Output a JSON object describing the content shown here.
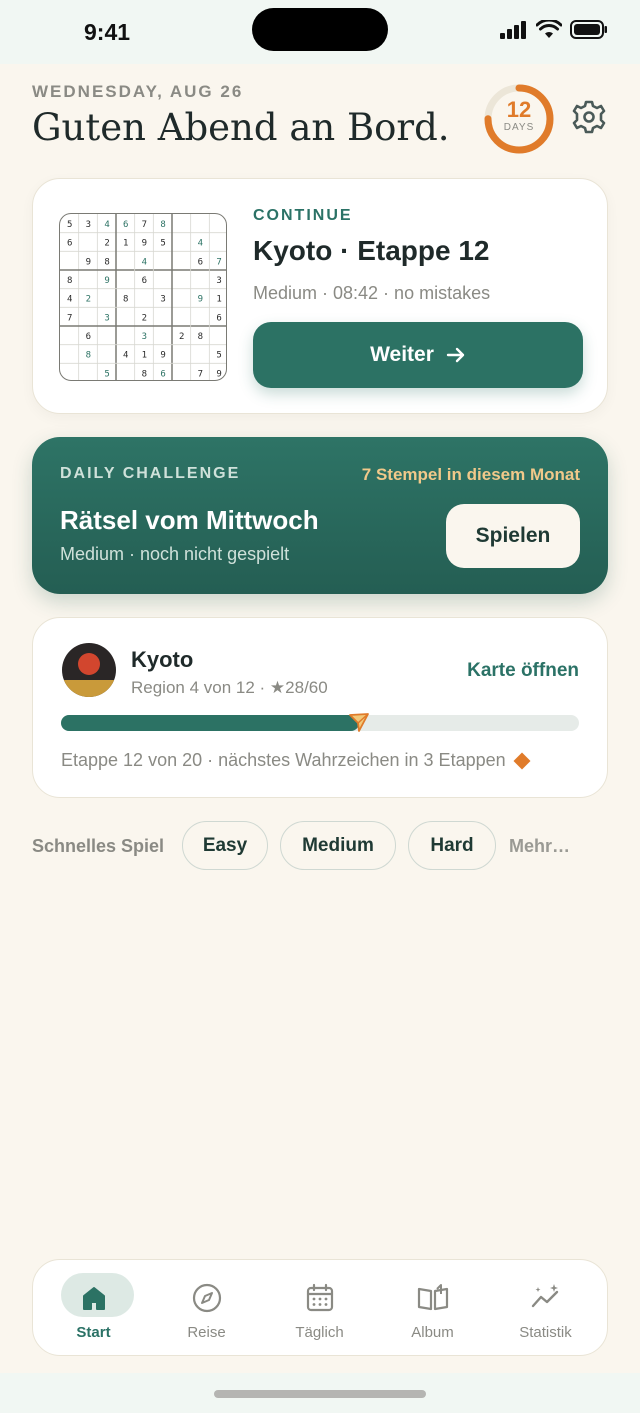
{
  "status_bar": {
    "time": "9:41"
  },
  "header": {
    "date": "WEDNESDAY, AUG 26",
    "greeting": "Guten Abend an Bord.",
    "streak": {
      "count": "12",
      "unit": "DAYS",
      "progress": 0.75
    },
    "settings_icon": "gear-icon"
  },
  "continue_card": {
    "label": "CONTINUE",
    "title": "Kyoto · Etappe 12",
    "subtitle": "Medium · 08:42 · no mistakes",
    "button_label": "Weiter",
    "button_icon": "arrow-right-icon",
    "mini_grid": [
      [
        "5",
        "3",
        "4",
        "6",
        "7",
        "8",
        "",
        "",
        ""
      ],
      [
        "6",
        "",
        "2",
        "1",
        "9",
        "5",
        "",
        "4",
        ""
      ],
      [
        "",
        "9",
        "8",
        "",
        "4",
        "",
        "",
        "6",
        "7"
      ],
      [
        "8",
        "",
        "9",
        "",
        "6",
        "",
        "",
        "",
        "3"
      ],
      [
        "4",
        "2",
        "",
        "8",
        "",
        "3",
        "",
        "9",
        "1"
      ],
      [
        "7",
        "",
        "3",
        "",
        "2",
        "",
        "",
        "",
        "6"
      ],
      [
        "",
        "6",
        "",
        "",
        "3",
        "",
        "2",
        "8",
        ""
      ],
      [
        "",
        "8",
        "",
        "4",
        "1",
        "9",
        "",
        "",
        "5"
      ],
      [
        "",
        "",
        "5",
        "",
        "8",
        "6",
        "",
        "7",
        "9"
      ]
    ],
    "mini_grid_user_cells": [
      [
        0,
        2
      ],
      [
        0,
        3
      ],
      [
        0,
        5
      ],
      [
        1,
        7
      ],
      [
        2,
        4
      ],
      [
        2,
        8
      ],
      [
        3,
        2
      ],
      [
        4,
        1
      ],
      [
        4,
        7
      ],
      [
        5,
        2
      ],
      [
        6,
        4
      ],
      [
        7,
        1
      ],
      [
        8,
        2
      ],
      [
        8,
        5
      ]
    ]
  },
  "daily_challenge": {
    "label": "DAILY CHALLENGE",
    "stamps": "7 Stempel in diesem Monat",
    "title": "Rätsel vom Mittwoch",
    "subtitle": "Medium · noch nicht gespielt",
    "button_label": "Spielen"
  },
  "journey": {
    "region": "Kyoto",
    "region_sub": "Region 4 von 12 · ★28/60",
    "map_link": "Karte öffnen",
    "progress": 0.575,
    "footer": "Etappe 12 von 20 · nächstes Wahrzeichen in 3 Etappen",
    "accent": "#e07b2a"
  },
  "quick_play": {
    "label": "Schnelles Spiel",
    "options": [
      "Easy",
      "Medium",
      "Hard"
    ],
    "more": "Mehr…"
  },
  "tabbar": {
    "tabs": [
      {
        "label": "Start",
        "icon": "home-icon",
        "active": true
      },
      {
        "label": "Reise",
        "icon": "compass-icon",
        "active": false
      },
      {
        "label": "Täglich",
        "icon": "calendar-icon",
        "active": false
      },
      {
        "label": "Album",
        "icon": "book-icon",
        "active": false
      },
      {
        "label": "Statistik",
        "icon": "stats-sparkle-icon",
        "active": false
      }
    ]
  },
  "colors": {
    "primary": "#2c7264",
    "accent": "#e07b2a",
    "background": "#faf6ee"
  }
}
